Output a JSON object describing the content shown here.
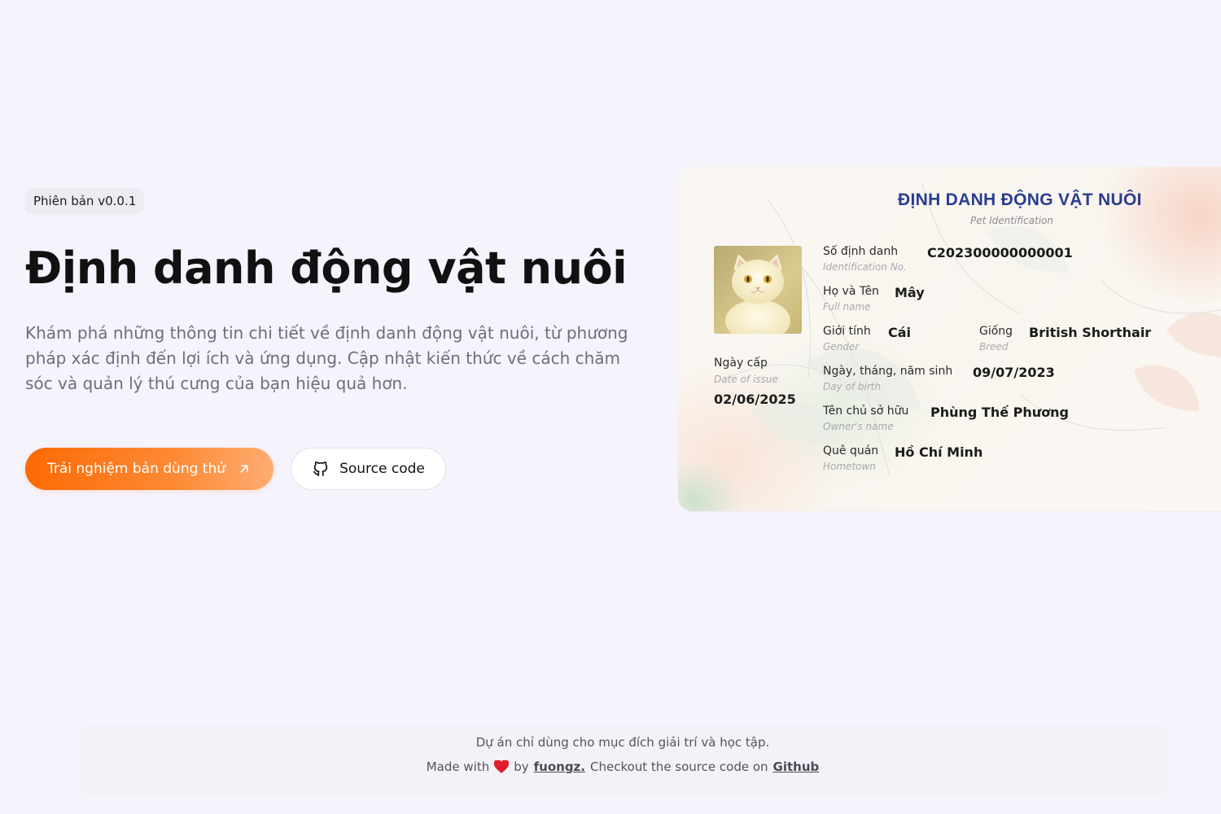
{
  "hero": {
    "badge": "Phiên bản v0.0.1",
    "title": "Định danh động vật nuôi",
    "description": "Khám phá những thông tin chi tiết về định danh động vật nuôi, từ phương pháp xác định đến lợi ích và ứng dụng. Cập nhật kiến thức về cách chăm sóc và quản lý thú cưng của bạn hiệu quả hơn.",
    "primary_button": "Trải nghiệm bản dùng thử",
    "secondary_button": "Source code"
  },
  "card": {
    "title": "ĐỊNH DANH ĐỘNG VẬT NUÔI",
    "subtitle": "Pet Identification",
    "issue_date": {
      "label": "Ngày cấp",
      "sublabel": "Date of issue",
      "value": "02/06/2025"
    },
    "id_number": {
      "label": "Số định danh",
      "sublabel": "Identification No.",
      "value": "C202300000000001"
    },
    "full_name": {
      "label": "Họ và Tên",
      "sublabel": "Full name",
      "value": "Mây"
    },
    "gender": {
      "label": "Giới tính",
      "sublabel": "Gender",
      "value": "Cái"
    },
    "breed": {
      "label": "Giống",
      "sublabel": "Breed",
      "value": "British Shorthair"
    },
    "birth_date": {
      "label": "Ngày, tháng, năm sinh",
      "sublabel": "Day of birth",
      "value": "09/07/2023"
    },
    "owner": {
      "label": "Tên chủ sở hữu",
      "sublabel": "Owner's name",
      "value": "Phùng Thế Phương"
    },
    "hometown": {
      "label": "Quê quán",
      "sublabel": "Hometown",
      "value": "Hồ Chí Minh"
    }
  },
  "footer": {
    "note": "Dự án chỉ dùng cho mục đích giải trí và học tập.",
    "made_with": "Made with",
    "by": "by",
    "author": "fuongz.",
    "checkout": "Checkout the source code on",
    "github": "Github"
  },
  "colors": {
    "accent": "#fc6a05",
    "card_title": "#2a3d8f",
    "heart": "#e11d2a",
    "background": "#f5f3fc"
  },
  "icons": {
    "primary_button": "arrow-up-right-icon",
    "secondary_button": "github-icon",
    "footer": "heart-icon"
  }
}
